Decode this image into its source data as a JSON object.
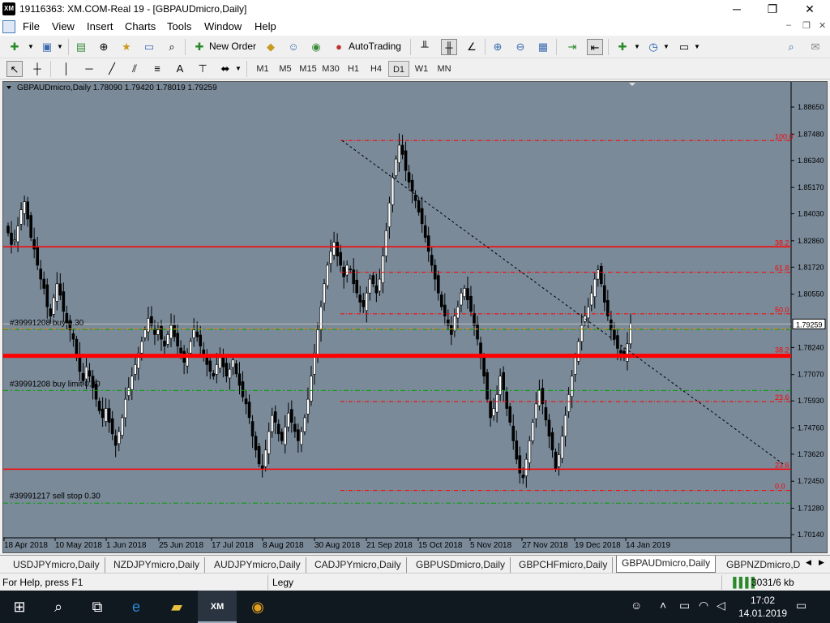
{
  "window": {
    "title": "19116363: XM.COM-Real 19 - [GBPAUDmicro,Daily]",
    "app_icon_label": "XM",
    "minimize": "─",
    "maximize": "❐",
    "close": "✕"
  },
  "menu": [
    "File",
    "View",
    "Insert",
    "Charts",
    "Tools",
    "Window",
    "Help"
  ],
  "toolbar": {
    "new_order_label": "New Order",
    "autotrading_label": "AutoTrading"
  },
  "timeframes": [
    {
      "label": "M1",
      "active": false
    },
    {
      "label": "M5",
      "active": false
    },
    {
      "label": "M15",
      "active": false
    },
    {
      "label": "M30",
      "active": false
    },
    {
      "label": "H1",
      "active": false
    },
    {
      "label": "H4",
      "active": false
    },
    {
      "label": "D1",
      "active": true
    },
    {
      "label": "W1",
      "active": false
    },
    {
      "label": "MN",
      "active": false
    }
  ],
  "chart": {
    "header": "GBPAUDmicro,Daily  1.78090 1.79420 1.78019 1.79259",
    "current_price": "1.79259",
    "price_labels": [
      "1.88650",
      "1.87480",
      "1.86340",
      "1.85170",
      "1.84030",
      "1.82860",
      "1.81720",
      "1.80550",
      "1.79259",
      "1.78240",
      "1.77070",
      "1.75930",
      "1.74760",
      "1.73620",
      "1.72450",
      "1.71280",
      "1.70140"
    ],
    "date_labels": [
      "18 Apr 2018",
      "10 May 2018",
      "1 Jun 2018",
      "25 Jun 2018",
      "17 Jul 2018",
      "8 Aug 2018",
      "30 Aug 2018",
      "21 Sep 2018",
      "15 Oct 2018",
      "5 Nov 2018",
      "27 Nov 2018",
      "19 Dec 2018",
      "14 Jan 2019"
    ],
    "orders": [
      "#39991208 buy 0.30",
      "#39991208 buy limit 0.30",
      "#39991217 sell stop 0.30"
    ],
    "fib_labels": [
      "100.0",
      "38.2",
      "61.8",
      "50.0",
      "38.2",
      "23.6",
      "23.6",
      "0.0"
    ],
    "colors": {
      "background": "#7a8a99",
      "candle": "#000000",
      "level_red": "#ff0000",
      "order_green": "#00a000",
      "fib_red": "#ff0000"
    }
  },
  "tabs": [
    {
      "label": "USDJPYmicro,Daily",
      "active": false
    },
    {
      "label": "NZDJPYmicro,Daily",
      "active": false
    },
    {
      "label": "AUDJPYmicro,Daily",
      "active": false
    },
    {
      "label": "CADJPYmicro,Daily",
      "active": false
    },
    {
      "label": "GBPUSDmicro,Daily",
      "active": false
    },
    {
      "label": "GBPCHFmicro,Daily",
      "active": false
    },
    {
      "label": "GBPAUDmicro,Daily",
      "active": true
    },
    {
      "label": "GBPNZDmicro,D",
      "active": false
    }
  ],
  "status": {
    "help": "For Help, press F1",
    "profile": "Legy",
    "traffic": "3031/6 kb"
  },
  "taskbar": {
    "time": "17:02",
    "date": "14.01.2019"
  }
}
